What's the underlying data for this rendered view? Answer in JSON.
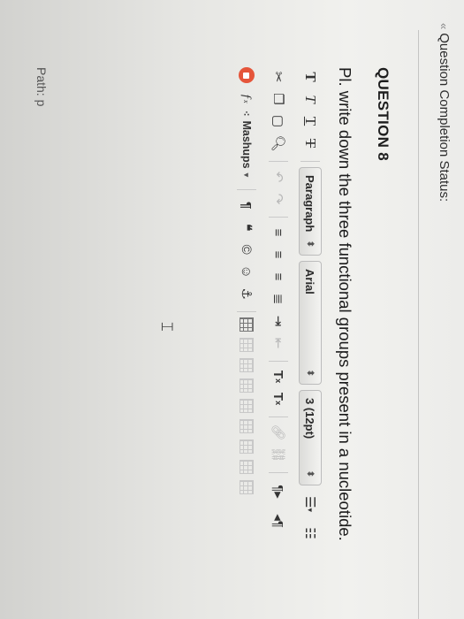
{
  "status": {
    "label": "Question Completion Status:",
    "chevron": "«"
  },
  "question": {
    "title": "QUESTION 8",
    "prompt": "Pl. write down the three functional groups present in a nucleotide."
  },
  "toolbar": {
    "row1": {
      "format_buttons": [
        {
          "name": "bold-icon",
          "glyph": "T"
        },
        {
          "name": "italic-icon",
          "glyph": "T"
        },
        {
          "name": "underline-icon",
          "glyph": "T"
        },
        {
          "name": "strikethrough-icon",
          "glyph": "T"
        }
      ],
      "paragraph_select": "Paragraph",
      "font_select": "Arial",
      "size_select": "3 (12pt)",
      "list_icons": [
        "bulleted-list-icon",
        "numbered-list-icon"
      ]
    },
    "row2": {
      "icons": [
        "cut-icon",
        "copy-icon",
        "paste-icon",
        "find-icon",
        "undo-icon",
        "redo-icon",
        "align-left-icon",
        "align-center-icon",
        "align-right-icon",
        "align-justify-icon",
        "indent-icon",
        "outdent-icon",
        "superscript-icon",
        "subscript-icon",
        "link-icon",
        "unlink-icon",
        "ltr-icon",
        "rtl-icon"
      ]
    },
    "row3": {
      "mashups_label": "Mashups",
      "icons": [
        "record-icon",
        "formula-icon",
        "mashups-icon",
        "pilcrow-icon",
        "quote-icon",
        "copyright-icon",
        "emoji-icon",
        "anchor-icon",
        "table-icon"
      ]
    }
  },
  "colors": {
    "record": "#e5553a",
    "text": "#1c1c1c",
    "background": "#ececea"
  },
  "editor": {
    "path_label": "Path: p"
  }
}
